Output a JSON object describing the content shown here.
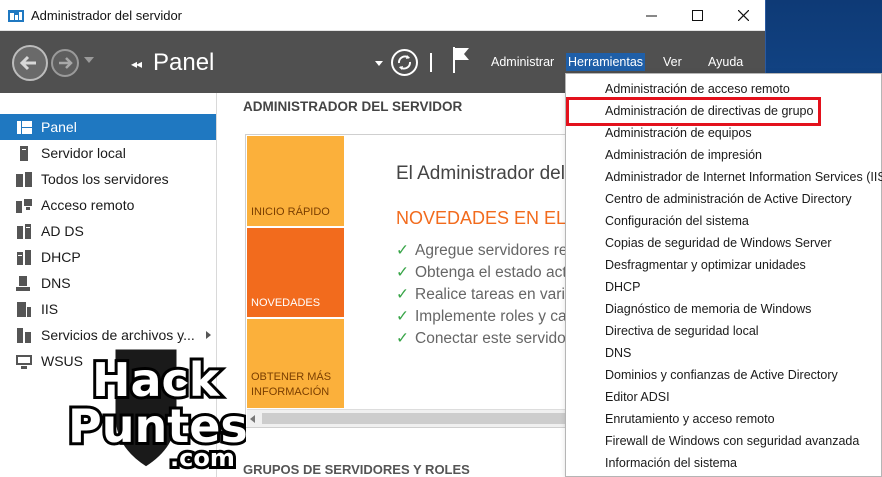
{
  "window": {
    "title": "Administrador del servidor"
  },
  "toolbar": {
    "crumb": "Panel",
    "menu": [
      "Administrar",
      "Herramientas",
      "Ver",
      "Ayuda"
    ],
    "active_menu": "Herramientas"
  },
  "sidebar": {
    "items": [
      {
        "label": "Panel",
        "icon": "dashboard-icon",
        "selected": true
      },
      {
        "label": "Servidor local",
        "icon": "server-icon"
      },
      {
        "label": "Todos los servidores",
        "icon": "servers-icon"
      },
      {
        "label": "Acceso remoto",
        "icon": "remote-access-icon"
      },
      {
        "label": "AD DS",
        "icon": "ad-ds-icon"
      },
      {
        "label": "DHCP",
        "icon": "dhcp-icon"
      },
      {
        "label": "DNS",
        "icon": "dns-icon"
      },
      {
        "label": "IIS",
        "icon": "iis-icon"
      },
      {
        "label": "Servicios de archivos y...",
        "icon": "file-services-icon"
      },
      {
        "label": "WSUS",
        "icon": "wsus-icon"
      }
    ]
  },
  "main": {
    "heading": "ADMINISTRADOR DEL SERVIDOR",
    "tiles": [
      "INICIO RÁPIDO",
      "NOVEDADES",
      "OBTENER MÁS INFORMACIÓN"
    ],
    "welcome": "El Administrador del",
    "news_title": "NOVEDADES EN EL",
    "tasks": [
      "Agregue servidores re",
      "Obtenga el estado act",
      "Realice tareas en vario",
      "Implemente roles y ca",
      "Conectar este servidor"
    ],
    "groups_heading": "GRUPOS DE SERVIDORES Y ROLES"
  },
  "dropdown": {
    "highlighted": "Administración de directivas de grupo",
    "highlight_color": "#e3111c",
    "items": [
      "Administración de acceso remoto",
      "Administración de directivas de grupo",
      "Administración de equipos",
      "Administración de impresión",
      "Administrador de Internet Information Services (IIS)",
      "Centro de administración de Active Directory",
      "Configuración del sistema",
      "Copias de seguridad de Windows Server",
      "Desfragmentar y optimizar unidades",
      "DHCP",
      "Diagnóstico de memoria de Windows",
      "Directiva de seguridad local",
      "DNS",
      "Dominios y confianzas de Active Directory",
      "Editor ADSI",
      "Enrutamiento y acceso remoto",
      "Firewall de Windows con seguridad avanzada",
      "Información del sistema"
    ]
  },
  "watermark": {
    "line1": "Hack",
    "line2": "Puntes",
    "line3": ".com"
  },
  "colors": {
    "accent": "#1f78c1",
    "toolbar": "#505050",
    "tile_orange": "#f26b1d",
    "tile_yellow": "#fbb03b"
  }
}
